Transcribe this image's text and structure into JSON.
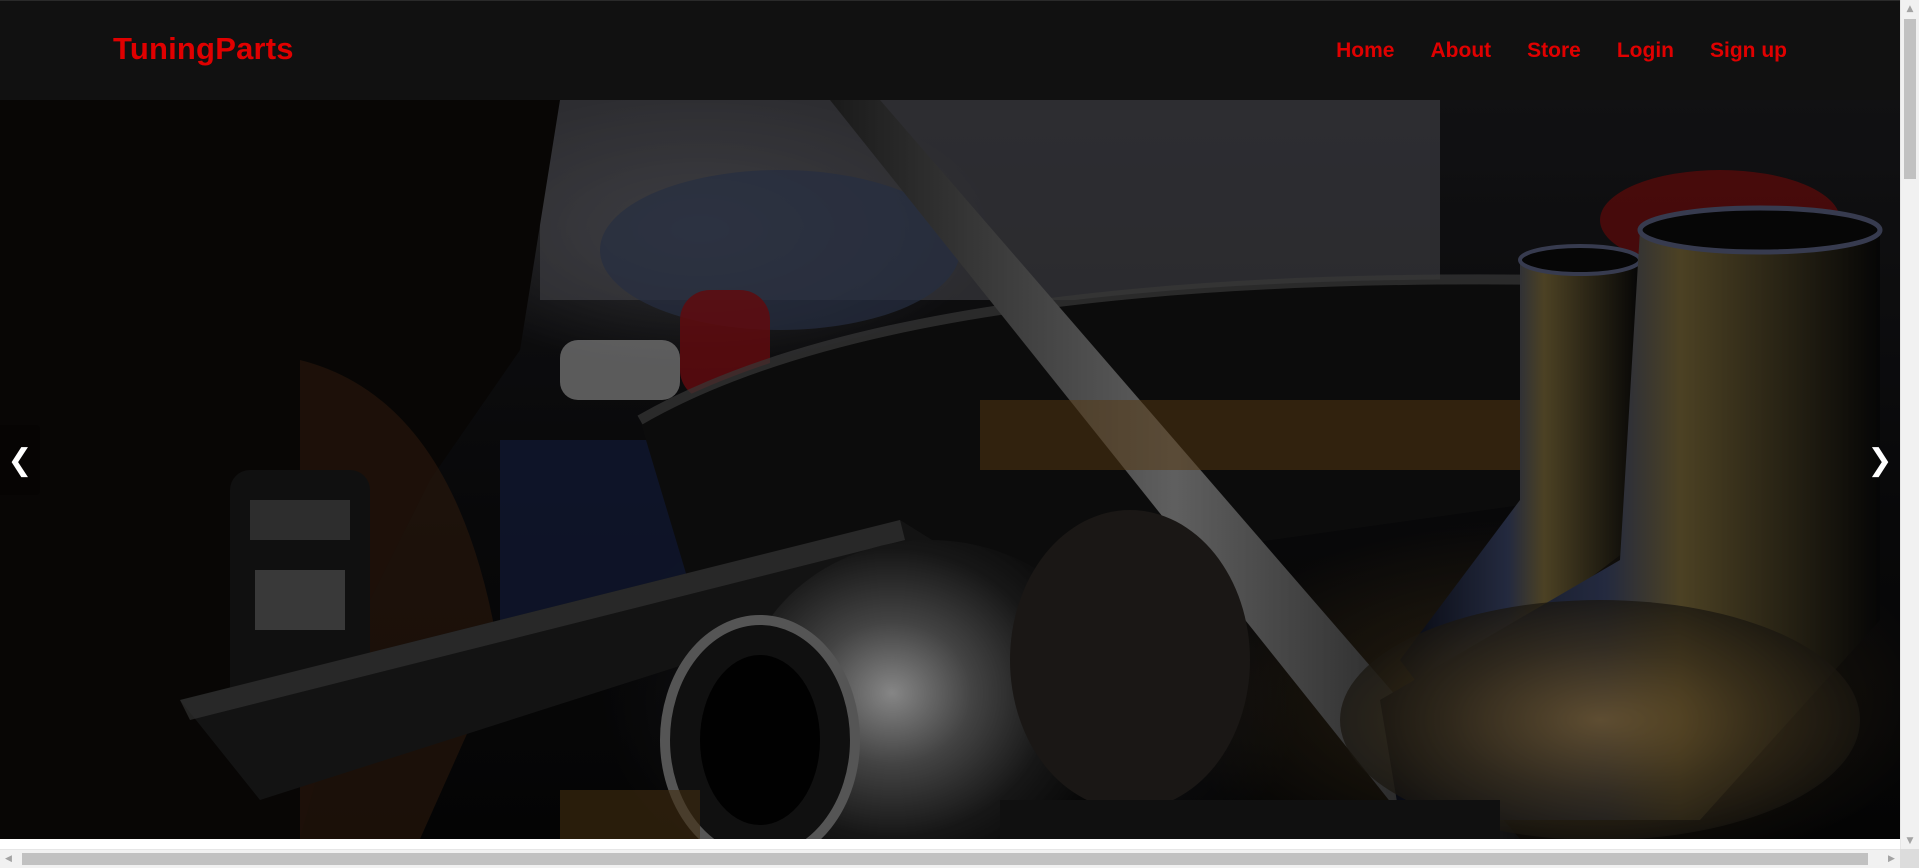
{
  "navbar": {
    "brand": "TuningParts",
    "links": [
      {
        "label": "Home"
      },
      {
        "label": "About"
      },
      {
        "label": "Store"
      },
      {
        "label": "Login"
      },
      {
        "label": "Sign up"
      }
    ]
  },
  "carousel": {
    "prev_label": "❮",
    "next_label": "❯",
    "slide_description_icon": "engine-bay-photo"
  },
  "scrollbars": {
    "up_arrow": "▲",
    "down_arrow": "▼",
    "left_arrow": "◀",
    "right_arrow": "▶"
  },
  "colors": {
    "accent": "#e00000",
    "navbar_bg": "#111111"
  }
}
